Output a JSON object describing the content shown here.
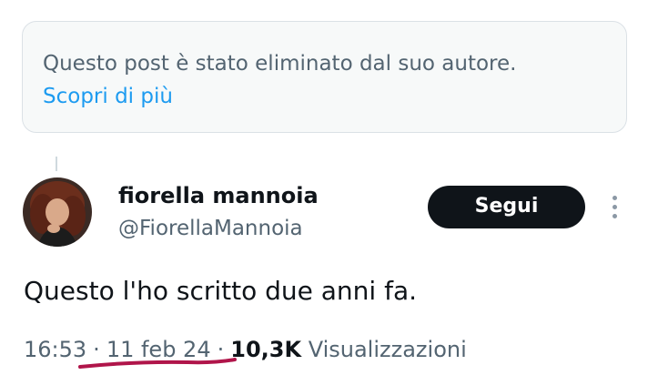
{
  "deleted_notice": {
    "message": "Questo post è stato eliminato dal suo autore.",
    "learn_more": "Scopri di più"
  },
  "tweet": {
    "author": {
      "display_name": "fiorella mannoia",
      "handle": "@FiorellaMannoia"
    },
    "follow_label": "Segui",
    "text": "Questo l'ho scritto due anni fa.",
    "time": "16:53",
    "separator": "·",
    "date": "11 feb 24",
    "views_count": "10,3K",
    "views_label": "Visualizzazioni"
  },
  "colors": {
    "text_primary": "#0f1419",
    "text_secondary": "#536471",
    "link": "#1d9bf0",
    "notice_bg": "#f7f9f9",
    "button_bg": "#0f1419",
    "annotation_underline": "#b0154a"
  },
  "icons": {
    "more": "more-vertical-icon"
  }
}
